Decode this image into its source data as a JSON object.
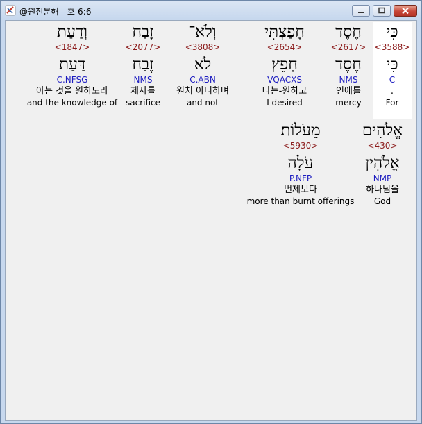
{
  "window": {
    "title": "@원전분해 - 호 6:6"
  },
  "words": [
    {
      "hebrew": "כִּי",
      "strong": "<3588>",
      "root": "כִּי",
      "morph": "C",
      "korean": ".",
      "english": "For",
      "highlight": true
    },
    {
      "hebrew": "חֶסֶד",
      "strong": "<2617>",
      "root": "חֶסֶד",
      "morph": "NMS",
      "korean": "인애를",
      "english": "mercy",
      "highlight": false
    },
    {
      "hebrew": "חָפַצְתִּי",
      "strong": "<2654>",
      "root": "חָפֵץ",
      "morph": "VQACXS",
      "korean": "나는-원하고",
      "english": "I desired",
      "highlight": false
    },
    {
      "hebrew": "וְלֹא־",
      "strong": "<3808>",
      "root": "לֹא",
      "morph": "C.ABN",
      "korean": "원치 아니하며",
      "english": "and not",
      "highlight": false
    },
    {
      "hebrew": "זָבַח",
      "strong": "<2077>",
      "root": "זֶבַח",
      "morph": "NMS",
      "korean": "제사를",
      "english": "sacrifice",
      "highlight": false
    },
    {
      "hebrew": "וְדַעַת",
      "strong": "<1847>",
      "root": "דַּעַת",
      "morph": "C.NFSG",
      "korean": "아는 것을 원하노라",
      "english": "and the knowledge of",
      "highlight": false
    },
    {
      "hebrew": "אֱלֹהִים",
      "strong": "<430>",
      "root": "אֱלֹהִין",
      "morph": "NMP",
      "korean": "하나님을",
      "english": "God",
      "highlight": false
    },
    {
      "hebrew": "מֵעֹלוֹת׃",
      "strong": "<5930>",
      "root": "עֹלָה",
      "morph": "P.NFP",
      "korean": "번제보다",
      "english": "more than burnt offerings",
      "highlight": false
    }
  ]
}
